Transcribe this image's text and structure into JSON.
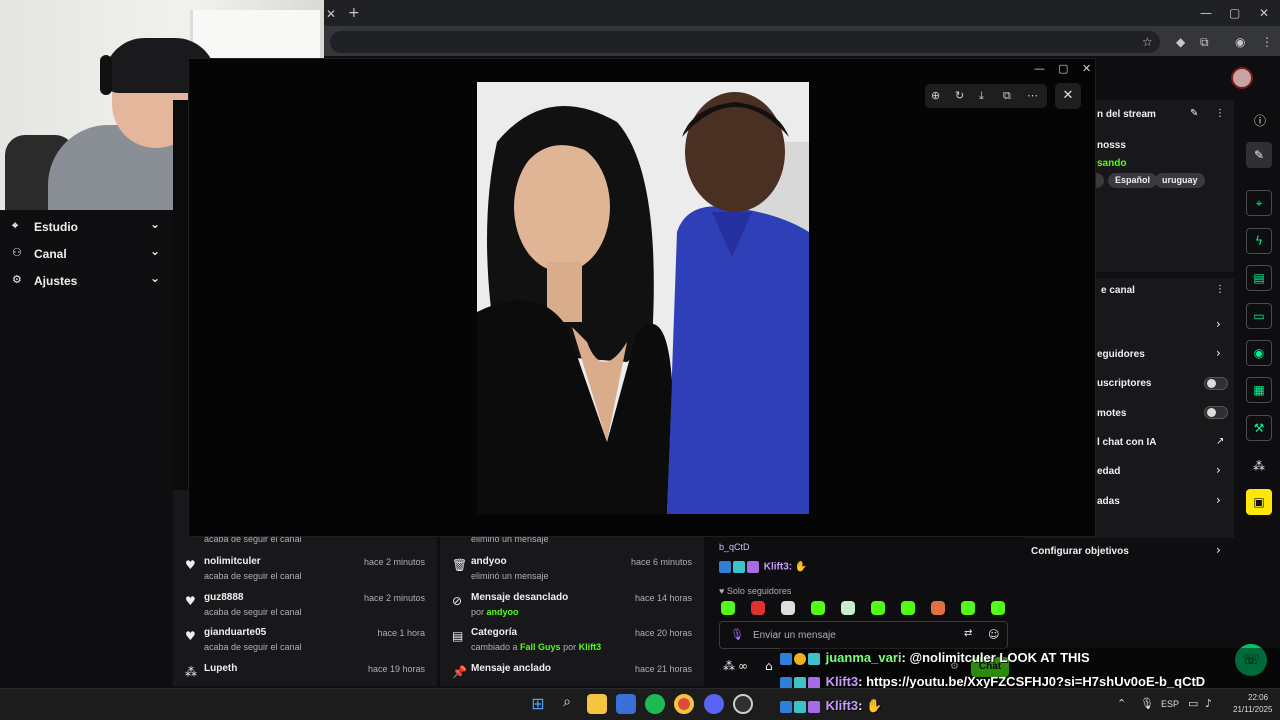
{
  "browser": {
    "new_tab_label": "+",
    "close_tab_label": "✕"
  },
  "sidebar": {
    "items": [
      {
        "label": "Estudio",
        "icon": "studio-icon"
      },
      {
        "label": "Canal",
        "icon": "channel-icon"
      },
      {
        "label": "Ajustes",
        "icon": "gear-icon"
      }
    ]
  },
  "viewer": {
    "tools": [
      "zoom-in-icon",
      "rotate-icon",
      "download-icon",
      "open-external-icon",
      "more-icon"
    ],
    "close_label": "✕"
  },
  "stream_info": {
    "title": "n del stream",
    "username": "nosss",
    "status": "sando",
    "tags": [
      "Español",
      "uruguay"
    ]
  },
  "channel_panel": {
    "title": "e canal",
    "rows": [
      {
        "label": "",
        "type": "chevron"
      },
      {
        "label": "eguidores",
        "type": "chevron"
      },
      {
        "label": "uscriptores",
        "type": "toggle"
      },
      {
        "label": "motes",
        "type": "toggle"
      },
      {
        "label": "l chat con IA",
        "type": "link"
      },
      {
        "label": "edad",
        "type": "chevron"
      },
      {
        "label": "adas",
        "type": "chevron"
      }
    ],
    "goals_label": "Configurar objetivos"
  },
  "activity": {
    "left": [
      {
        "name": "",
        "sub": "acaba de seguir el canal",
        "time": ""
      },
      {
        "name": "nolimitculer",
        "sub": "acaba de seguir el canal",
        "time": "hace 2 minutos"
      },
      {
        "name": "guz8888",
        "sub": "acaba de seguir el canal",
        "time": "hace 2 minutos"
      },
      {
        "name": "gianduarte05",
        "sub": "acaba de seguir el canal",
        "time": "hace 1 hora"
      },
      {
        "name": "Lupeth",
        "sub": "",
        "time": "hace 19 horas"
      }
    ],
    "right": [
      {
        "name": "",
        "sub": "eliminó un mensaje",
        "time": ""
      },
      {
        "name": "andyoo",
        "sub": "eliminó un mensaje",
        "time": "hace 6 minutos"
      },
      {
        "name": "Mensaje desanclado",
        "sub_prefix": "por",
        "sub_user": "andyoo",
        "time": "hace 14 horas"
      },
      {
        "name": "Categoría",
        "sub_prefix": "cambiado a",
        "sub_user": "Fall Guys",
        "sub_mid": "por",
        "sub_user2": "Klift3",
        "time": "hace 20 horas"
      },
      {
        "name": "Mensaje anclado",
        "sub": "",
        "time": "hace 21 horas"
      }
    ]
  },
  "chat": {
    "partial_link": "b_qCtD",
    "last_user": "Klift3:",
    "followers_only": "Solo seguidores",
    "input_placeholder": "Enviar un mensaje",
    "chat_button": "Chat"
  },
  "overlay_chat": [
    {
      "user": "juanma_vari",
      "message": ": @nolimitculer LOOK AT THIS"
    },
    {
      "user": "Klift3",
      "message": ": https://youtu.be/XxyFZCSFHJ0?si=H7shUv0oE-b_qCtD"
    },
    {
      "user": "Klift3",
      "message": ":"
    }
  ],
  "taskbar": {
    "lang": "ESP",
    "time": "22:06",
    "date": "21/11/2025"
  },
  "colors": {
    "accent": "#53fc18",
    "background": "#0e0e10",
    "panel": "#18181b"
  }
}
